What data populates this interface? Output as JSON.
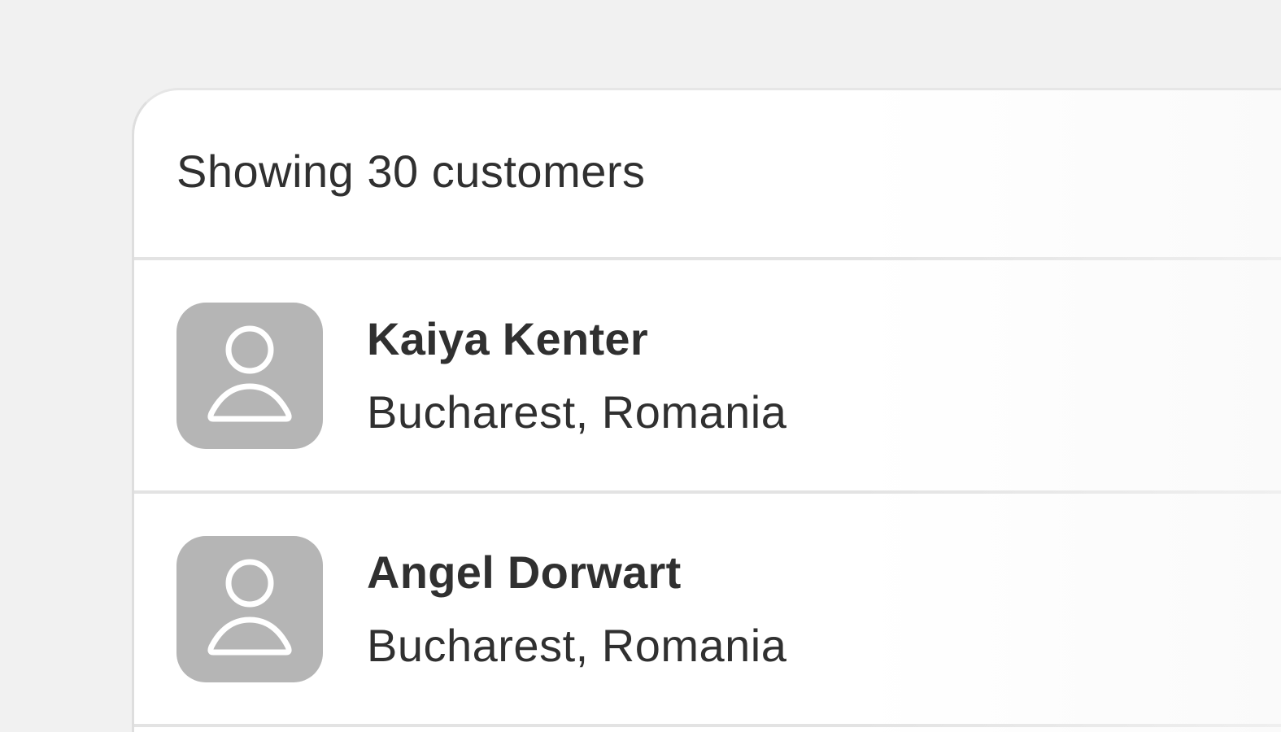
{
  "customers_list": {
    "summary": "Showing 30 customers",
    "items": [
      {
        "name": "Kaiya Kenter",
        "location": "Bucharest, Romania",
        "avatar_icon": "person-placeholder-icon"
      },
      {
        "name": "Angel Dorwart",
        "location": "Bucharest, Romania",
        "avatar_icon": "person-placeholder-icon"
      }
    ]
  },
  "colors": {
    "page_background": "#f1f1f1",
    "card_background": "#ffffff",
    "avatar_background": "#b5b5b5",
    "text": "#303030",
    "divider": "#e3e3e3"
  }
}
